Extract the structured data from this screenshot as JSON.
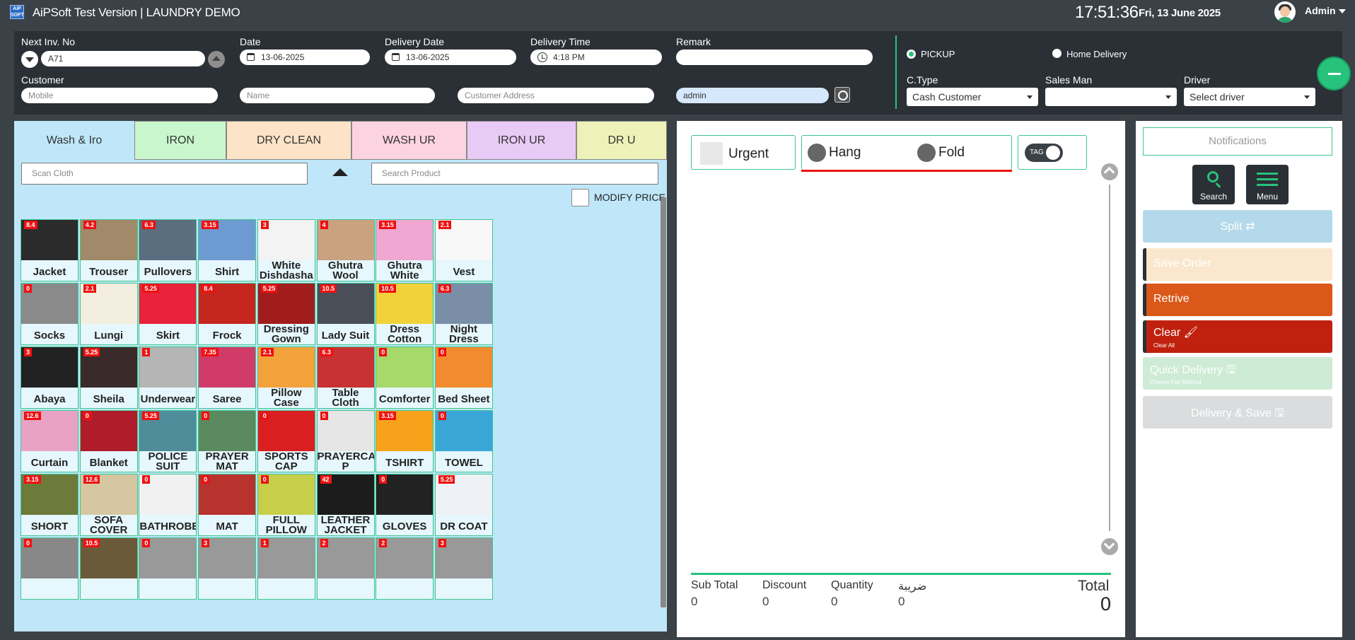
{
  "app": {
    "logo_text": "AiP SOFT",
    "title": "AiPSoft Test Version | LAUNDRY DEMO",
    "time": "17:51:36",
    "date": "Fri, 13 June 2025",
    "user": "Admin"
  },
  "header": {
    "next_inv_label": "Next Inv. No",
    "next_inv_value": "A71",
    "date_label": "Date",
    "date_value": "13-06-2025",
    "delivery_date_label": "Delivery Date",
    "delivery_date_value": "13-06-2025",
    "delivery_time_label": "Delivery Time",
    "delivery_time_value": "4:18 PM",
    "remark_label": "Remark",
    "remark_value": "",
    "customer_label": "Customer",
    "mobile_placeholder": "Mobile",
    "name_placeholder": "Name",
    "address_placeholder": "Customer Address",
    "user_field_value": "admin",
    "pickup_label": "PICKUP",
    "home_delivery_label": "Home Delivery",
    "ctype_label": "C.Type",
    "ctype_value": "Cash Customer",
    "salesman_label": "Sales Man",
    "salesman_value": "",
    "driver_label": "Driver",
    "driver_value": "Select driver"
  },
  "tabs": [
    {
      "label": "Wash & Iro",
      "color": "#bfe7f9"
    },
    {
      "label": "IRON",
      "color": "#c9f7cd"
    },
    {
      "label": "DRY CLEAN",
      "color": "#fde3c7"
    },
    {
      "label": "WASH UR",
      "color": "#fcd3e1"
    },
    {
      "label": "IRON UR",
      "color": "#e9c9f6"
    },
    {
      "label": "DR U",
      "color": "#eef2b8"
    }
  ],
  "left": {
    "scan_placeholder": "Scan Cloth",
    "search_placeholder": "Search Product",
    "modify_price_label": "MODIFY PRICE"
  },
  "products": [
    {
      "price": "8.4",
      "name": "Jacket"
    },
    {
      "price": "4.2",
      "name": "Trouser"
    },
    {
      "price": "6.3",
      "name": "Pullovers"
    },
    {
      "price": "3.15",
      "name": "Shirt"
    },
    {
      "price": "3",
      "name": "White Dishdasha"
    },
    {
      "price": "4",
      "name": "Ghutra Wool"
    },
    {
      "price": "3.15",
      "name": "Ghutra White"
    },
    {
      "price": "2.1",
      "name": "Vest"
    },
    {
      "price": "0",
      "name": "Socks"
    },
    {
      "price": "2.1",
      "name": "Lungi"
    },
    {
      "price": "5.25",
      "name": "Skirt"
    },
    {
      "price": "8.4",
      "name": "Frock"
    },
    {
      "price": "5.25",
      "name": "Dressing Gown"
    },
    {
      "price": "10.5",
      "name": "Lady Suit"
    },
    {
      "price": "10.5",
      "name": "Dress Cotton"
    },
    {
      "price": "6.3",
      "name": "Night Dress"
    },
    {
      "price": "3",
      "name": "Abaya"
    },
    {
      "price": "5.25",
      "name": "Sheila"
    },
    {
      "price": "1",
      "name": "Underwear"
    },
    {
      "price": "7.35",
      "name": "Saree"
    },
    {
      "price": "2.1",
      "name": "Pillow Case"
    },
    {
      "price": "6.3",
      "name": "Table Cloth"
    },
    {
      "price": "0",
      "name": "Comforter"
    },
    {
      "price": "0",
      "name": "Bed Sheet"
    },
    {
      "price": "12.6",
      "name": "Curtain"
    },
    {
      "price": "0",
      "name": "Blanket"
    },
    {
      "price": "5.25",
      "name": "POLICE SUIT"
    },
    {
      "price": "0",
      "name": "PRAYER MAT"
    },
    {
      "price": "0",
      "name": "SPORTS CAP"
    },
    {
      "price": "0",
      "name": "PRAYERCA P"
    },
    {
      "price": "3.15",
      "name": "TSHIRT"
    },
    {
      "price": "0",
      "name": "TOWEL"
    },
    {
      "price": "3.15",
      "name": "SHORT"
    },
    {
      "price": "12.6",
      "name": "SOFA COVER"
    },
    {
      "price": "0",
      "name": "BATHROBE"
    },
    {
      "price": "0",
      "name": "MAT"
    },
    {
      "price": "0",
      "name": "FULL PILLOW"
    },
    {
      "price": "42",
      "name": "LEATHER JACKET"
    },
    {
      "price": "0",
      "name": "GLOVES"
    },
    {
      "price": "5.25",
      "name": "DR COAT"
    },
    {
      "price": "0",
      "name": ""
    },
    {
      "price": "10.5",
      "name": ""
    },
    {
      "price": "0",
      "name": ""
    },
    {
      "price": "3",
      "name": ""
    },
    {
      "price": "1",
      "name": ""
    },
    {
      "price": "2",
      "name": ""
    },
    {
      "price": "2",
      "name": ""
    },
    {
      "price": "3",
      "name": ""
    }
  ],
  "order": {
    "urgent_label": "Urgent",
    "hang_label": "Hang",
    "fold_label": "Fold",
    "tag_label": "TAG",
    "subtotal_label": "Sub Total",
    "subtotal_value": "0",
    "discount_label": "Discount",
    "discount_value": "0",
    "quantity_label": "Quantity",
    "quantity_value": "0",
    "tax_label": "ضريبة",
    "tax_value": "0",
    "total_label": "Total",
    "total_value": "0"
  },
  "actions": {
    "notifications": "Notifications",
    "search": "Search",
    "menu": "Menu",
    "split": "Split ⇄",
    "save_order": "Save Order",
    "retrive": "Retrive",
    "clear": "Clear 🖌",
    "clear_sub": "Clear All",
    "quick_delivery": "Quick Delivery 🖫",
    "quick_delivery_sub": "Choose Pay Method",
    "delivery_save": "Delivery & Save 🖫"
  }
}
